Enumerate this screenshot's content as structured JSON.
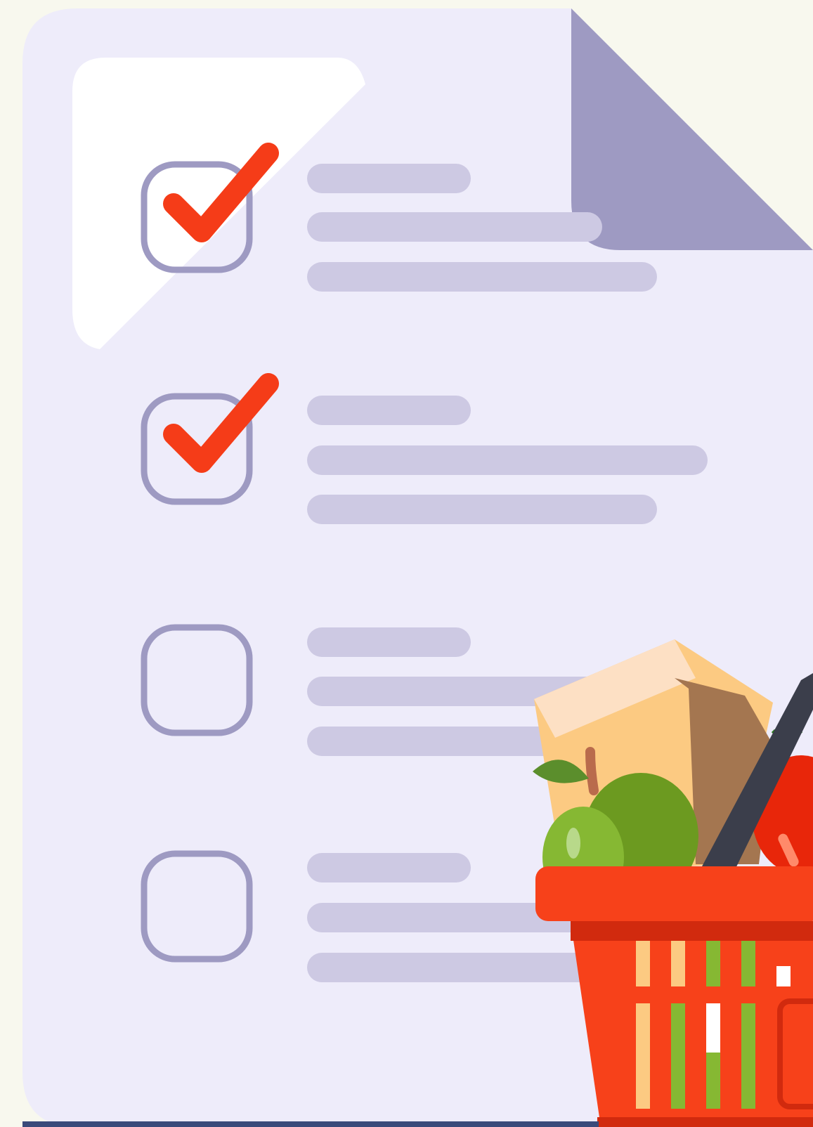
{
  "colors": {
    "background": "#f8f8ee",
    "paper": "#eeecfa",
    "paper_fold": "#9e9ac2",
    "highlight": "#ffffff",
    "checkbox_border": "#9e9ac2",
    "checkmark": "#f53c18",
    "text_line": "#cdc9e3",
    "basket": "#f7411a",
    "basket_dark": "#d12a0e",
    "basket_handle": "#3b3e4b",
    "apple_green": "#6c9a20",
    "apple_light": "#86b833",
    "carton": "#fcca82",
    "carton_side": "#a47650",
    "tomato": "#e8260a"
  },
  "checklist": {
    "items": [
      {
        "checked": true,
        "icon": "checkmark-icon"
      },
      {
        "checked": true,
        "icon": "checkmark-icon"
      },
      {
        "checked": false,
        "icon": "empty-checkbox-icon"
      },
      {
        "checked": false,
        "icon": "empty-checkbox-icon"
      }
    ]
  },
  "illustration": {
    "basket_icon": "shopping-basket-icon",
    "contents": [
      "milk-carton-icon",
      "green-apple-icon",
      "tomato-icon"
    ]
  }
}
